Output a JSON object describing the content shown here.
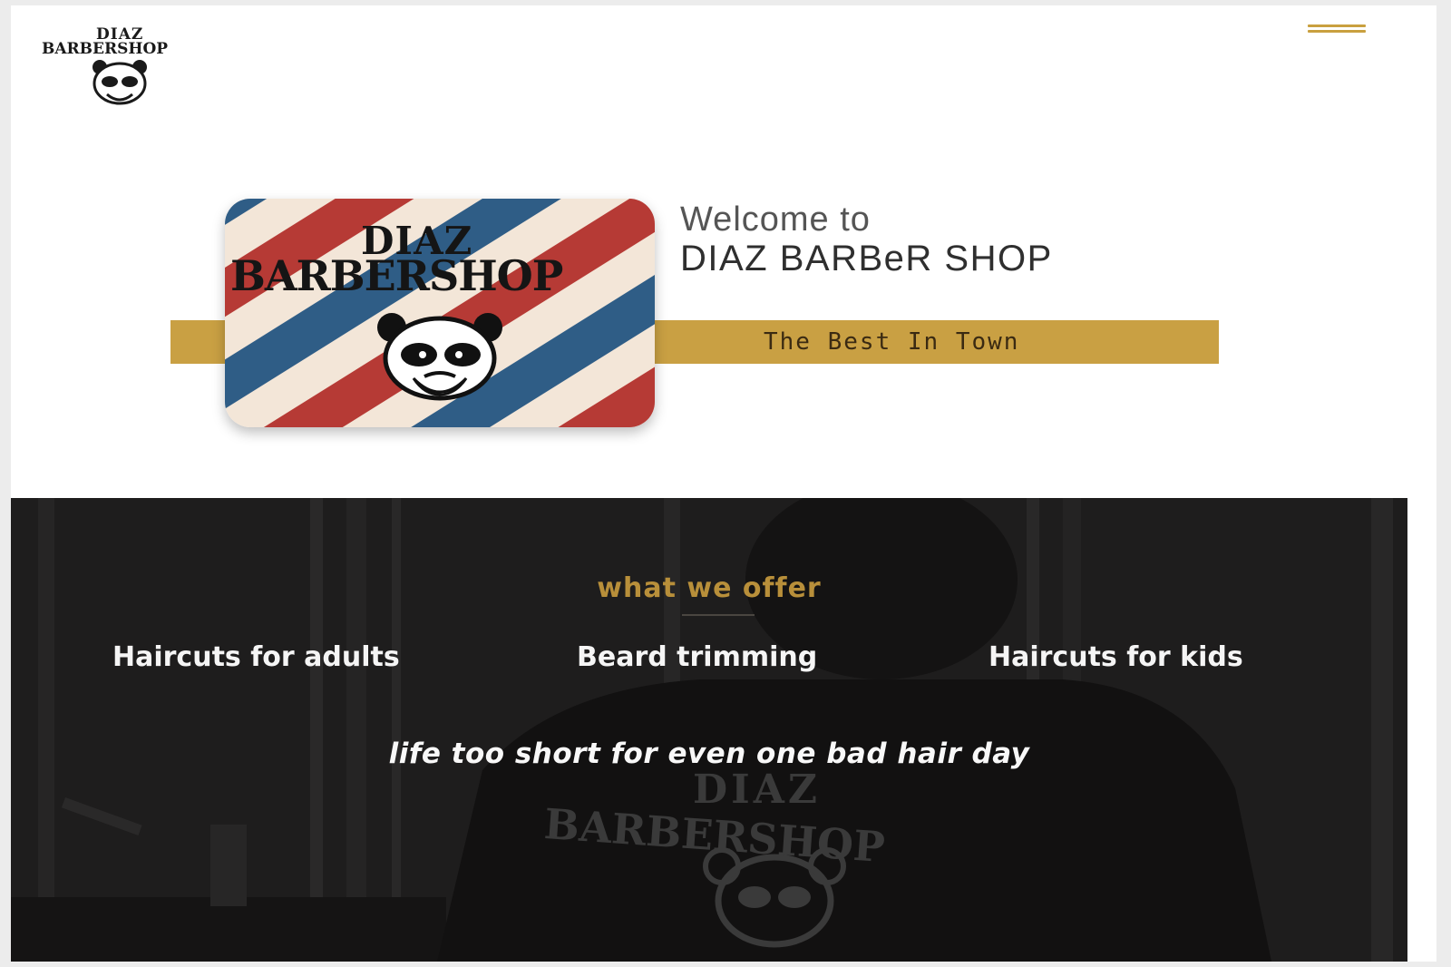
{
  "header": {
    "logo_line1": "DIAZ",
    "logo_line2": "BARBERSHOP",
    "menu_icon": "hamburger-menu-icon"
  },
  "hero": {
    "tile_line1": "DIAZ",
    "tile_line2": "BARBERSHOP",
    "welcome": "Welcome to",
    "shop_name": "DIAZ BARBeR SHOP",
    "tagline": "The Best In Town"
  },
  "offer": {
    "title": "what we offer",
    "services": [
      "Haircuts for adults",
      "Beard trimming",
      "Haircuts for kids"
    ],
    "quote": "life too short for even one bad hair day",
    "shirt_line1": "DIAZ",
    "shirt_line2": "BARBERSHOP"
  },
  "colors": {
    "gold": "#c9a043",
    "dark_bg": "#1c1b1b",
    "stripe_red": "#b63a35",
    "stripe_blue": "#2f5d86",
    "stripe_cream": "#f3e6d8"
  }
}
